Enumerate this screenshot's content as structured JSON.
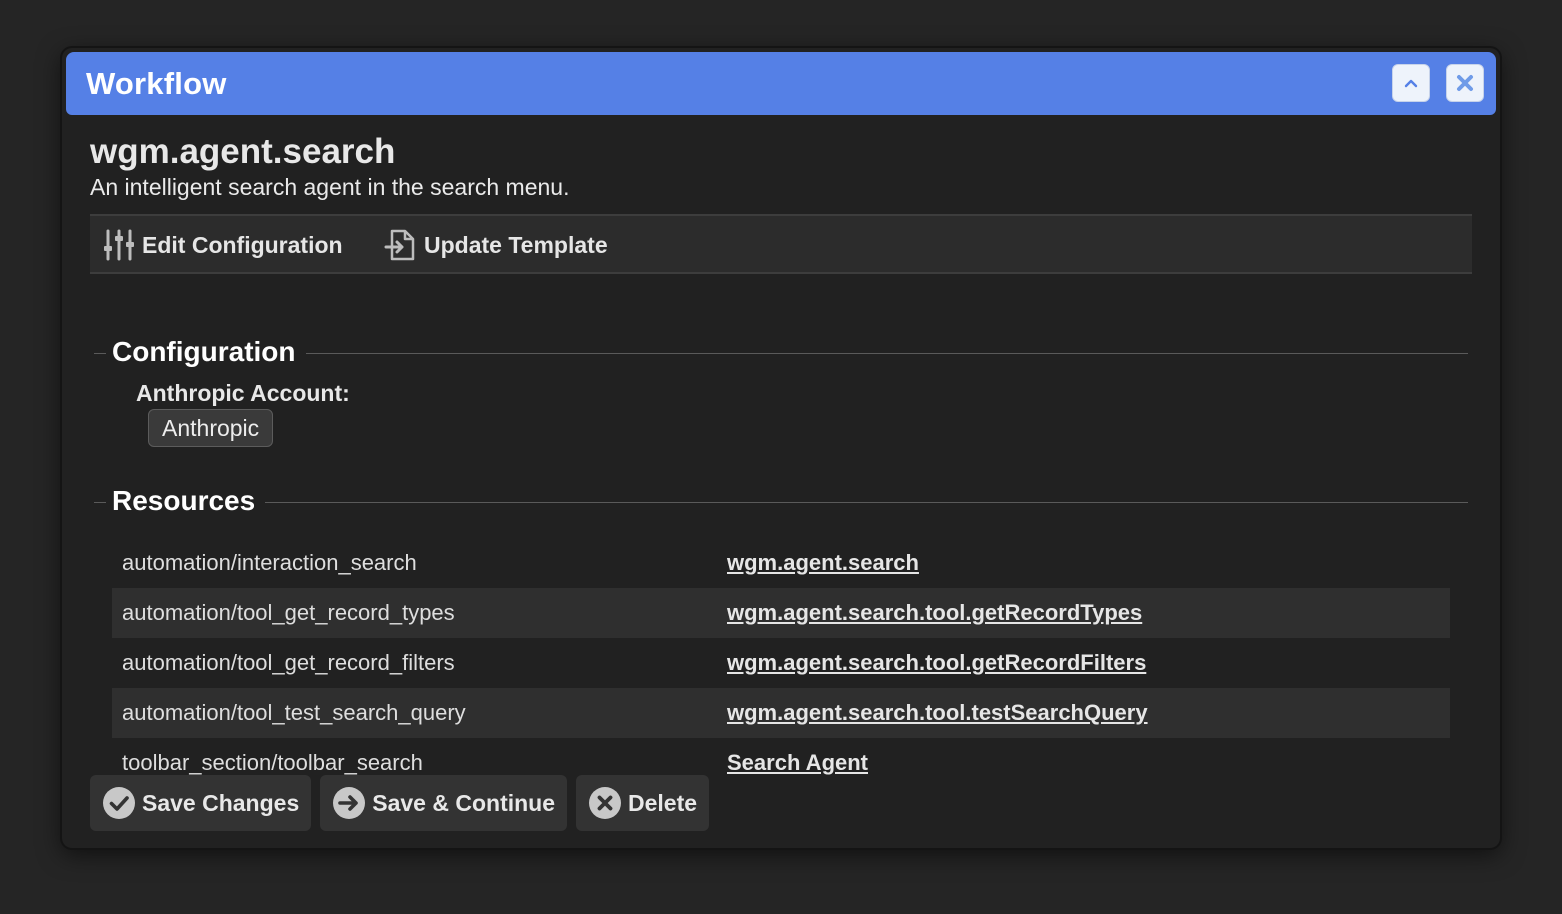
{
  "window": {
    "title": "Workflow"
  },
  "workflow": {
    "name": "wgm.agent.search",
    "description": "An intelligent search agent in the search menu."
  },
  "toolbar": {
    "edit_label": "Edit Configuration",
    "update_label": "Update Template"
  },
  "configuration": {
    "heading": "Configuration",
    "account_label": "Anthropic Account:",
    "account_value": "Anthropic"
  },
  "resources": {
    "heading": "Resources",
    "rows": [
      {
        "key": "automation/interaction_search",
        "value": "wgm.agent.search"
      },
      {
        "key": "automation/tool_get_record_types",
        "value": "wgm.agent.search.tool.getRecordTypes"
      },
      {
        "key": "automation/tool_get_record_filters",
        "value": "wgm.agent.search.tool.getRecordFilters"
      },
      {
        "key": "automation/tool_test_search_query",
        "value": "wgm.agent.search.tool.testSearchQuery"
      },
      {
        "key": "toolbar_section/toolbar_search",
        "value": "Search Agent"
      }
    ]
  },
  "footer": {
    "save_label": "Save Changes",
    "save_continue_label": "Save & Continue",
    "delete_label": "Delete"
  },
  "colors": {
    "titlebar": "#5580e6",
    "background": "#212121",
    "page": "#252525"
  }
}
